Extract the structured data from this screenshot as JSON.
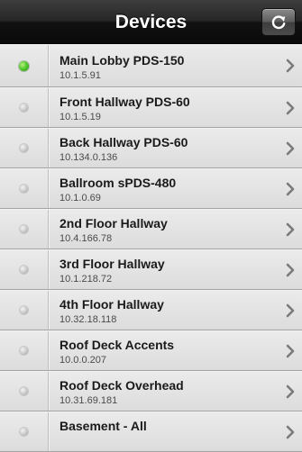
{
  "navbar": {
    "title": "Devices",
    "refresh_icon": "refresh-icon"
  },
  "devices": [
    {
      "name": "Main Lobby PDS-150",
      "ip": "10.1.5.91",
      "status": "online"
    },
    {
      "name": "Front Hallway PDS-60",
      "ip": "10.1.5.19",
      "status": "offline"
    },
    {
      "name": "Back Hallway PDS-60",
      "ip": "10.134.0.136",
      "status": "offline"
    },
    {
      "name": "Ballroom sPDS-480",
      "ip": "10.1.0.69",
      "status": "offline"
    },
    {
      "name": "2nd Floor Hallway",
      "ip": "10.4.166.78",
      "status": "offline"
    },
    {
      "name": "3rd Floor Hallway",
      "ip": "10.1.218.72",
      "status": "offline"
    },
    {
      "name": "4th Floor Hallway",
      "ip": "10.32.18.118",
      "status": "offline"
    },
    {
      "name": "Roof Deck Accents",
      "ip": "10.0.0.207",
      "status": "offline"
    },
    {
      "name": "Roof Deck Overhead",
      "ip": "10.31.69.181",
      "status": "offline"
    },
    {
      "name": "Basement - All",
      "ip": "",
      "status": "offline"
    }
  ],
  "colors": {
    "online": "#4fc52a",
    "offline": "#c8c8c8",
    "navbar": "#1e1e1e"
  }
}
